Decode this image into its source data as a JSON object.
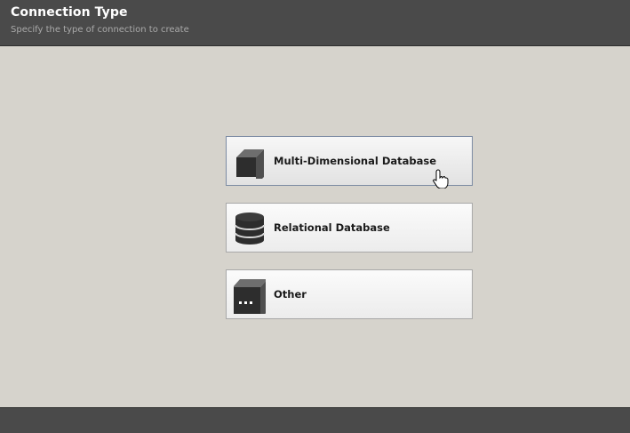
{
  "header": {
    "title": "Connection Type",
    "subtitle": "Specify the type of connection to create"
  },
  "options": [
    {
      "label": "Multi-Dimensional Database",
      "icon": "cube-icon",
      "state": "hovered"
    },
    {
      "label": "Relational Database",
      "icon": "database-icon",
      "state": "normal"
    },
    {
      "label": "Other",
      "icon": "ellipsis-box-icon",
      "state": "normal"
    }
  ],
  "colors": {
    "header_bg": "#4a4a4a",
    "body_bg": "#d6d3cc",
    "icon_dark": "#2d2d2d",
    "hover_border": "#7c8ba3"
  },
  "cursor": "hand-pointer-icon"
}
